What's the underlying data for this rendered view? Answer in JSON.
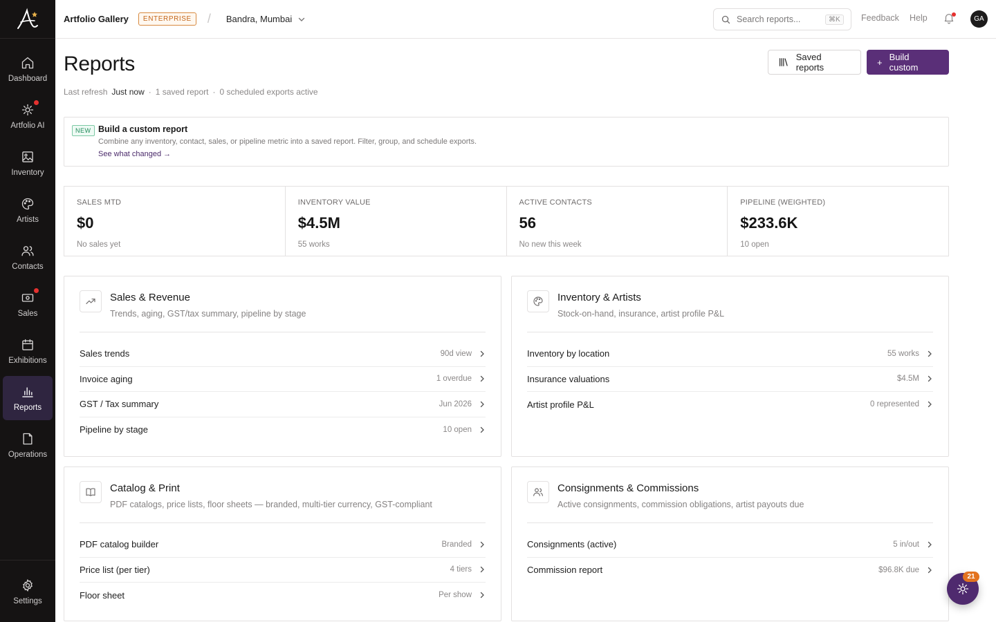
{
  "sidebar": {
    "items": [
      {
        "label": "Dashboard"
      },
      {
        "label": "Artfolio AI"
      },
      {
        "label": "Inventory"
      },
      {
        "label": "Artists"
      },
      {
        "label": "Contacts"
      },
      {
        "label": "Sales"
      },
      {
        "label": "Exhibitions"
      },
      {
        "label": "Reports"
      },
      {
        "label": "Operations"
      }
    ],
    "settings_label": "Settings",
    "active": "Reports"
  },
  "topbar": {
    "org_name": "Artfolio Gallery",
    "tier_badge": "ENTERPRISE",
    "separator": "/",
    "location": "Bandra, Mumbai",
    "search_placeholder": "Search reports...",
    "search_shortcut": "⌘K",
    "feedback": "Feedback",
    "help": "Help",
    "avatar_initials": "GA"
  },
  "header": {
    "title": "Reports",
    "last_refresh_label": "Last refresh",
    "last_refresh_value": "Just now",
    "dot": "·",
    "saved_count": "1 saved report",
    "scheduled": "0 scheduled exports active",
    "saved_reports_button": "Saved reports",
    "build_custom_button": "Build custom",
    "build_custom_prefix": "+"
  },
  "banner": {
    "badge": "NEW",
    "title": "Build a custom report",
    "description": "Combine any inventory, contact, sales, or pipeline metric into a saved report. Filter, group, and schedule exports.",
    "link": "See what changed →"
  },
  "kpis": [
    {
      "label": "SALES MTD",
      "value": "$0",
      "sub": "No sales yet"
    },
    {
      "label": "INVENTORY VALUE",
      "value": "$4.5M",
      "sub": "55 works"
    },
    {
      "label": "ACTIVE CONTACTS",
      "value": "56",
      "sub": "No new this week"
    },
    {
      "label": "PIPELINE (WEIGHTED)",
      "value": "$233.6K",
      "sub": "10 open"
    }
  ],
  "cards": [
    {
      "title": "Sales & Revenue",
      "description": "Trends, aging, GST/tax summary, pipeline by stage",
      "icon": "trending-up-icon",
      "rows": [
        {
          "label": "Sales trends",
          "meta": "90d view"
        },
        {
          "label": "Invoice aging",
          "meta": "1 overdue"
        },
        {
          "label": "GST / Tax summary",
          "meta": "Jun 2026"
        },
        {
          "label": "Pipeline by stage",
          "meta": "10 open"
        }
      ]
    },
    {
      "title": "Inventory & Artists",
      "description": "Stock-on-hand, insurance, artist profile P&L",
      "icon": "palette-icon",
      "rows": [
        {
          "label": "Inventory by location",
          "meta": "55 works"
        },
        {
          "label": "Insurance valuations",
          "meta": "$4.5M"
        },
        {
          "label": "Artist profile P&L",
          "meta": "0 represented"
        }
      ]
    },
    {
      "title": "Catalog & Print",
      "description": "PDF catalogs, price lists, floor sheets — branded, multi-tier currency, GST-compliant",
      "icon": "book-icon",
      "rows": [
        {
          "label": "PDF catalog builder",
          "meta": "Branded"
        },
        {
          "label": "Price list (per tier)",
          "meta": "4 tiers"
        },
        {
          "label": "Floor sheet",
          "meta": "Per show"
        }
      ]
    },
    {
      "title": "Consignments & Commissions",
      "description": "Active consignments, commission obligations, artist payouts due",
      "icon": "users-icon",
      "rows": [
        {
          "label": "Consignments (active)",
          "meta": "5 in/out"
        },
        {
          "label": "Commission report",
          "meta": "$96.8K due"
        }
      ]
    }
  ],
  "fab": {
    "badge": "21"
  },
  "colors": {
    "accent": "#5a2f78",
    "sidebar": "#151313",
    "badge_orange": "#e3731f",
    "dot_red": "#e5312f"
  }
}
